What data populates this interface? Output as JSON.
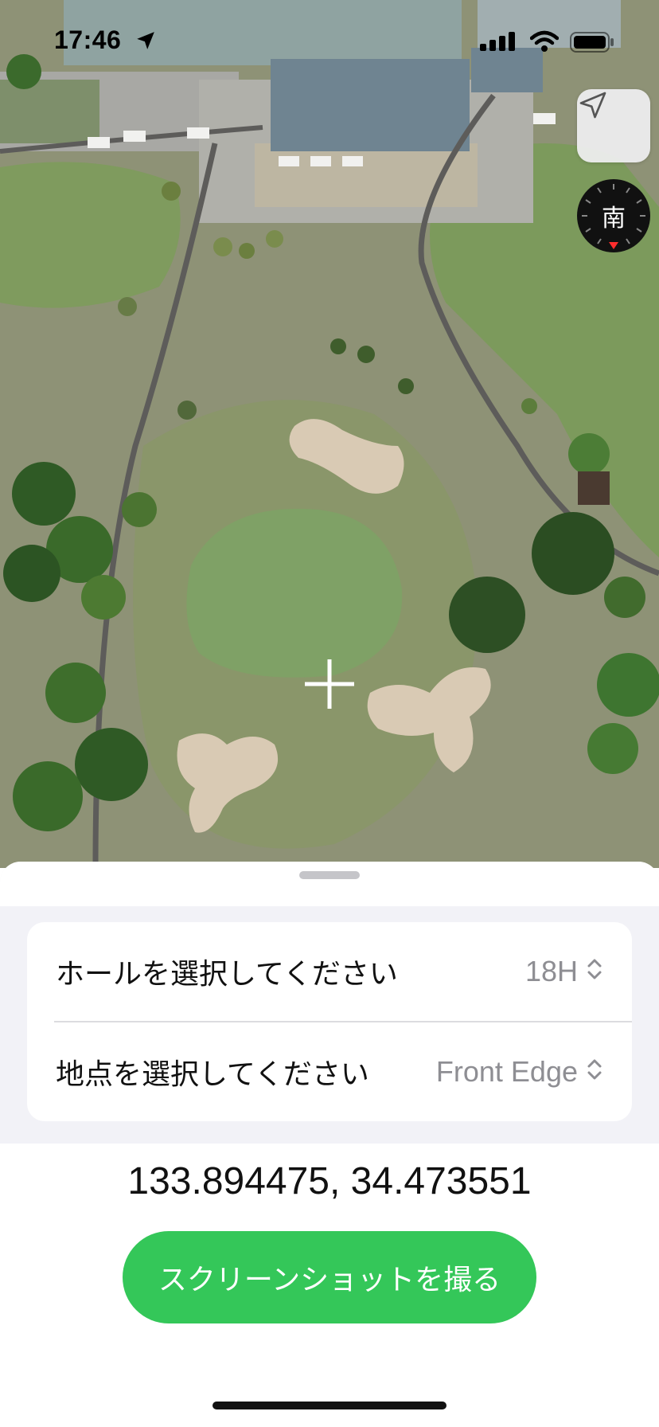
{
  "status_bar": {
    "time": "17:46",
    "icons": [
      "location-arrow-icon",
      "cellular-signal-icon",
      "wifi-icon",
      "battery-icon"
    ]
  },
  "map": {
    "type": "satellite",
    "compass_label": "南",
    "locate_icon": "location-arrow-icon",
    "center_marker": "crosshair-icon"
  },
  "sheet": {
    "hole_row": {
      "label": "ホールを選択してください",
      "value": "18H",
      "icon": "chevron-up-down-icon"
    },
    "point_row": {
      "label": "地点を選択してください",
      "value": "Front Edge",
      "icon": "chevron-up-down-icon"
    },
    "coordinates": "133.894475, 34.473551",
    "screenshot_button": "スクリーンショットを撮る"
  },
  "colors": {
    "accent_green": "#34c759",
    "sheet_background": "#f2f2f7",
    "secondary_text": "#8e8e93"
  }
}
